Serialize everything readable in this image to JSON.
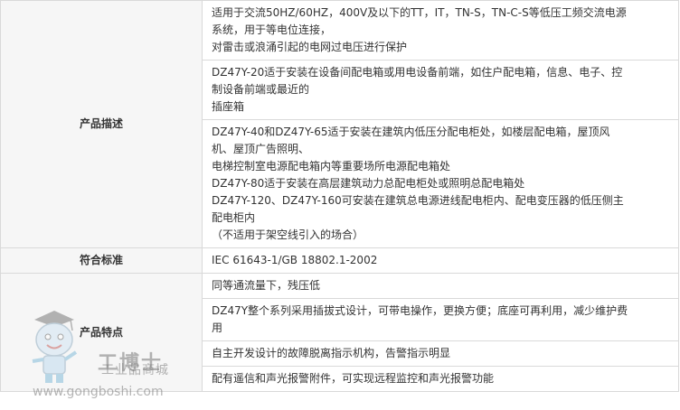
{
  "rows": {
    "description": {
      "label": "产品描述",
      "cells": [
        [
          "适用于交流50HZ/60HZ，400V及以下的TT，IT，TN-S，TN-C-S等低压工频交流电源",
          "系统，用于等电位连接，",
          "对雷击或浪涌引起的电网过电压进行保护"
        ],
        [
          "DZ47Y-20适于安装在设备间配电箱或用电设备前端，如住户配电箱，信息、电子、控",
          "制设备前端或最近的",
          "插座箱"
        ],
        [
          "DZ47Y-40和DZ47Y-65适于安装在建筑内低压分配电柜处，如楼层配电箱，屋顶风",
          "机、屋顶广告照明、",
          "电梯控制室电源配电箱内等重要场所电源配电箱处",
          "DZ47Y-80适于安装在高层建筑动力总配电柜处或照明总配电箱处",
          "DZ47Y-120、DZ47Y-160可安装在建筑总电源进线配电柜内、配电变压器的低压侧主",
          "配电柜内",
          "（不适用于架空线引入的场合）"
        ]
      ]
    },
    "standard": {
      "label": "符合标准",
      "value": "IEC 61643-1/GB 18802.1-2002"
    },
    "features": {
      "label": "产品特点",
      "items": [
        [
          "同等通流量下，残压低"
        ],
        [
          "DZ47Y整个系列采用插拔式设计，可带电操作，更换方便；底座可再利用，减少维护费",
          "用"
        ],
        [
          "自主开发设计的故障脱离指示机构，告警指示明显"
        ],
        [
          "配有遥信和声光报警附件，可实现远程监控和声光报警功能"
        ]
      ]
    }
  },
  "watermark": {
    "brand": "工博士",
    "subtitle": "工业品商城",
    "url": "www.gongboshi.com"
  }
}
